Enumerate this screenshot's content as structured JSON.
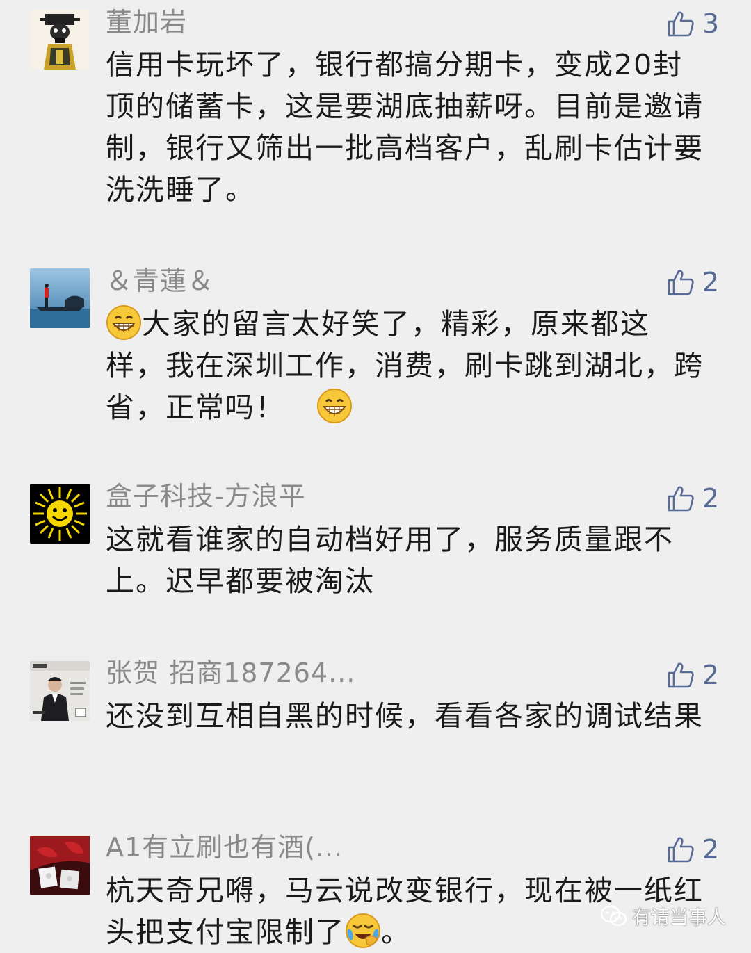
{
  "comments": [
    {
      "name": "董加岩",
      "likes": "3",
      "avatar": "opera-mask-avatar",
      "text": "信用卡玩坏了，银行都搞分期卡，变成20封顶的储蓄卡，这是要湖底抽薪呀。目前是邀请制，银行又筛出一批高档客户，乱刷卡估计要洗洗睡了。"
    },
    {
      "name": "＆青蓮＆",
      "likes": "2",
      "avatar": "lake-boat-avatar",
      "text_before": "大家的留言太好笑了，精彩，原来都这样，我在深圳工作，消费，刷卡跳到湖北，跨省，正常吗！",
      "emoji": "grin-emoji"
    },
    {
      "name": "盒子科技-方浪平",
      "likes": "2",
      "avatar": "sun-avatar",
      "text": "这就看谁家的自动档好用了，服务质量跟不上。迟早都要被淘汰"
    },
    {
      "name": "张贺 招商187264...",
      "likes": "2",
      "avatar": "magazine-portrait-avatar",
      "text": "还没到互相自黑的时候，看看各家的调试结果"
    },
    {
      "name": "A1有立刷也有酒(...",
      "likes": "2",
      "avatar": "red-gifts-avatar",
      "text_before": "杭天奇兄嘚，马云说改变银行，现在被一纸红头把支付宝限制了",
      "text_after": "。",
      "emoji": "crying-laugh-emoji"
    }
  ],
  "watermark": "有请当事人",
  "colors": {
    "background": "#efefef",
    "like": "#576b95",
    "name": "#8a8a8a",
    "text": "#1a1a1a"
  }
}
